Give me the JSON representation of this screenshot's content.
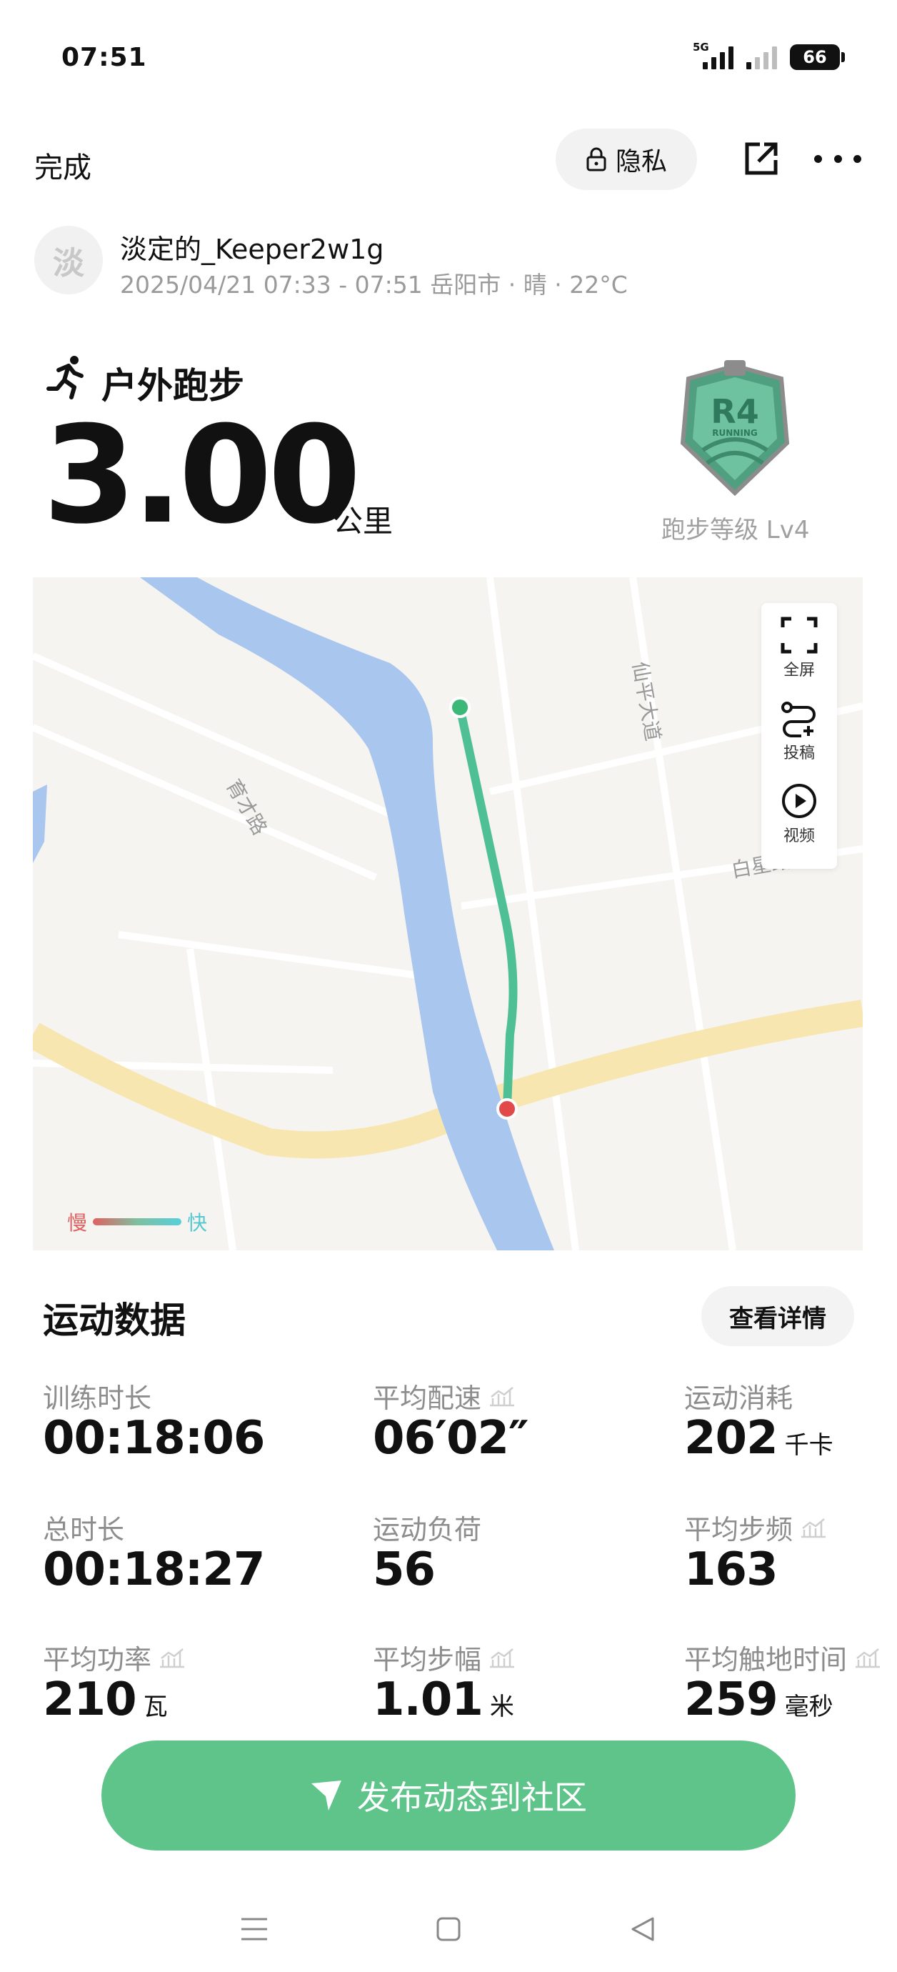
{
  "status_bar": {
    "time": "07:51",
    "network_tag": "5G",
    "battery": "66"
  },
  "header": {
    "done_label": "完成",
    "privacy_label": "隐私"
  },
  "user": {
    "avatar_text": "淡",
    "name": "淡定的_Keeper2w1g",
    "meta": "2025/04/21 07:33 - 07:51 岳阳市 · 晴 · 22°C"
  },
  "activity": {
    "type": "户外跑步",
    "distance": "3.00",
    "distance_unit": "公里",
    "badge_label": "跑步等级 Lv4",
    "badge_code": "R4",
    "badge_sub": "RUNNING"
  },
  "map": {
    "tools": [
      {
        "label": "全屏",
        "icon": "fullscreen-icon"
      },
      {
        "label": "投稿",
        "icon": "route-submit-icon"
      },
      {
        "label": "视频",
        "icon": "play-video-icon"
      }
    ],
    "road_labels": [
      "育才路",
      "仙平大道",
      "白星路"
    ],
    "legend_slow": "慢",
    "legend_fast": "快",
    "route_colors": {
      "start": "#3cb878",
      "end": "#e24a4a",
      "line": "#4fbf96"
    }
  },
  "stats": {
    "title": "运动数据",
    "detail_button": "查看详情",
    "items": [
      {
        "label": "训练时长",
        "value": "00:18:06",
        "unit": ""
      },
      {
        "label": "平均配速",
        "value": "06′02″",
        "unit": ""
      },
      {
        "label": "运动消耗",
        "value": "202",
        "unit": "千卡"
      },
      {
        "label": "总时长",
        "value": "00:18:27",
        "unit": ""
      },
      {
        "label": "运动负荷",
        "value": "56",
        "unit": ""
      },
      {
        "label": "平均步频",
        "value": "163",
        "unit": ""
      },
      {
        "label": "平均功率",
        "value": "210",
        "unit": "瓦"
      },
      {
        "label": "平均步幅",
        "value": "1.01",
        "unit": "米"
      },
      {
        "label": "平均触地时间",
        "value": "259",
        "unit": "毫秒"
      }
    ]
  },
  "publish": {
    "label": "发布动态到社区"
  },
  "colors": {
    "accent": "#5ec48a",
    "river": "#a8c6ee",
    "main_road": "#f8e6b0"
  }
}
